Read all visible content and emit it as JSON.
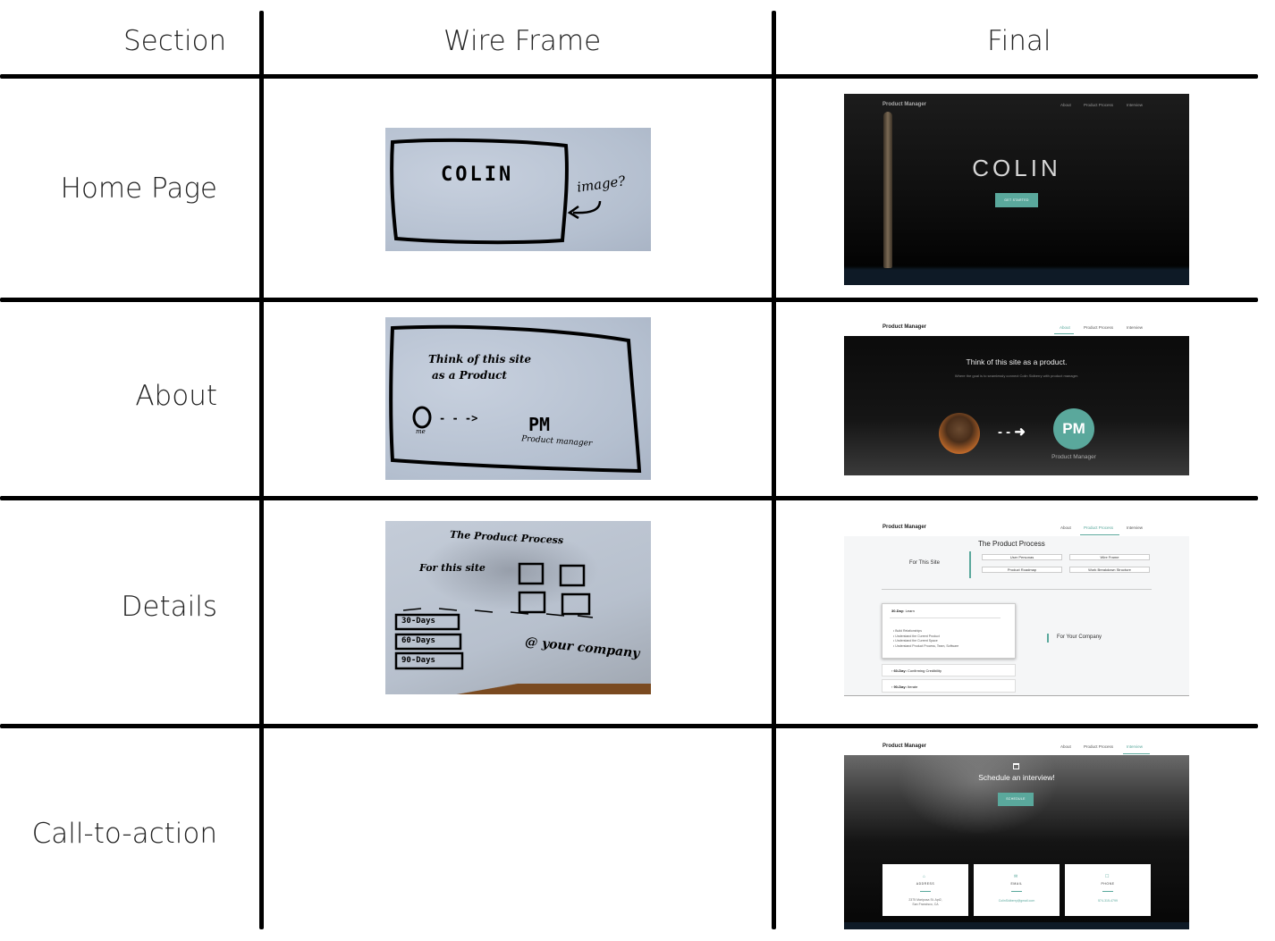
{
  "headers": {
    "section": "Section",
    "wireframe": "Wire Frame",
    "final": "Final"
  },
  "rows": [
    {
      "label": "Home Page"
    },
    {
      "label": "About"
    },
    {
      "label": "Details"
    },
    {
      "label": "Call-to-action"
    }
  ],
  "wireframes": {
    "home": {
      "title": "COLIN",
      "note": "image?"
    },
    "about": {
      "line1": "Think of this site",
      "line2": "as a Product",
      "arrow": "- - ->",
      "pm": "PM",
      "pm_sub": "Product manager",
      "me": "me"
    },
    "details": {
      "title": "The Product Process",
      "for_site": "For this site",
      "days": [
        "30-Days",
        "60-Days",
        "90-Days"
      ],
      "company": "@ your company"
    }
  },
  "finals": {
    "nav": {
      "brand": "Product Manager",
      "items": [
        "About",
        "Product Process",
        "Interview"
      ]
    },
    "home": {
      "title": "COLIN",
      "cta": "GET STARTED"
    },
    "about": {
      "heading": "Think of this site as a product.",
      "subheading": "Where the goal is to seamlessly connect Colin Sidberry with product manager.",
      "arrow": "- - ➜",
      "pm": "PM",
      "pm_label": "Product Manager"
    },
    "details": {
      "title": "The Product Process",
      "for_site": "For This Site",
      "chips": [
        "User Personas",
        "Wire Frame",
        "Product Roadmap",
        "Work Breakdown Structure"
      ],
      "accordion": [
        {
          "day": "30-Day:",
          "text": "Learn"
        },
        {
          "day": "60-Day:",
          "text": "Confirming Credibility"
        },
        {
          "day": "90-Day:",
          "text": "Iterate"
        }
      ],
      "bullets": [
        "Build Relationships",
        "Understand the Current Product",
        "Understand the Current Space",
        "Understand Product Process, Team, Software"
      ],
      "for_company": "For Your Company"
    },
    "cta": {
      "heading": "Schedule an interview!",
      "button": "SCHEDULE",
      "cards": [
        {
          "title": "ADDRESS",
          "line1": "2375 Mariposa St. Apt2,",
          "line2": "San Francisco, CA"
        },
        {
          "title": "EMAIL",
          "line1": "ColinSidberry@gmail.com",
          "line2": ""
        },
        {
          "title": "PHONE",
          "line1": "574-315-4799",
          "line2": ""
        }
      ]
    }
  },
  "colors": {
    "teal": "#5aa89c",
    "dark": "#0a0a0a",
    "grid": "#000000"
  }
}
